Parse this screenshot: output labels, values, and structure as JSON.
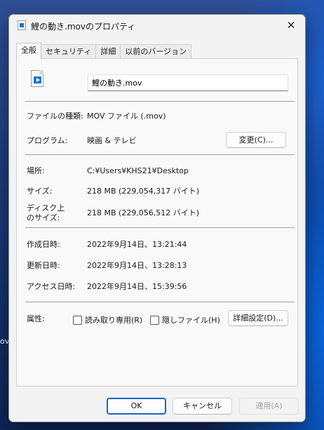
{
  "desktop": {
    "label": "ov"
  },
  "window": {
    "title": "鯉の動き.movのプロパティ",
    "close_glyph": "✕"
  },
  "tabs": [
    {
      "label": "全般",
      "active": true
    },
    {
      "label": "セキュリティ"
    },
    {
      "label": "詳細"
    },
    {
      "label": "以前のバージョン"
    }
  ],
  "general": {
    "filename": "鯉の動き.mov",
    "file_type_label": "ファイルの種類:",
    "file_type_value": "MOV ファイル (.mov)",
    "program_label": "プログラム:",
    "program_value": "映画 & テレビ",
    "change_button": "変更(C)...",
    "location_label": "場所:",
    "location_value": "C:¥Users¥KHS21¥Desktop",
    "size_label": "サイズ:",
    "size_value": "218 MB (229,054,317 バイト)",
    "disk_size_label_line1": "ディスク上",
    "disk_size_label_line2": "のサイズ:",
    "disk_size_value": "218 MB (229,056,512 バイト)",
    "created_label": "作成日時:",
    "created_value": "2022年9月14日、13:21:44",
    "modified_label": "更新日時:",
    "modified_value": "2022年9月14日、13:28:13",
    "accessed_label": "アクセス日時:",
    "accessed_value": "2022年9月14日、15:39:56",
    "attributes_label": "属性:",
    "readonly_label": "読み取り専用(R)",
    "readonly_checked": false,
    "hidden_label": "隠しファイル(H)",
    "hidden_checked": false,
    "advanced_button": "詳細設定(D)..."
  },
  "footer": {
    "ok": "OK",
    "cancel": "キャンセル",
    "apply": "適用(A)"
  }
}
